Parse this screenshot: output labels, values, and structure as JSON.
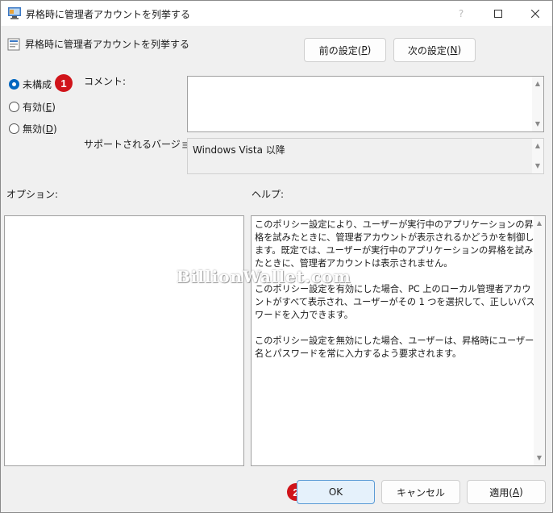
{
  "window": {
    "title": "昇格時に管理者アカウントを列挙する",
    "help_icon": "?",
    "maximize_icon": "maximize-icon",
    "close_icon": "close-icon"
  },
  "policy": {
    "title": "昇格時に管理者アカウントを列挙する"
  },
  "nav": {
    "prev_label": "前の設定(",
    "prev_key": "P",
    "prev_suffix": ")",
    "next_label": "次の設定(",
    "next_key": "N",
    "next_suffix": ")"
  },
  "state": {
    "options": [
      {
        "label": "未構成",
        "key": "",
        "selected": true
      },
      {
        "label": "有効(",
        "key": "E",
        "suffix": ")",
        "selected": false
      },
      {
        "label": "無効(",
        "key": "D",
        "suffix": ")",
        "selected": false
      }
    ]
  },
  "fields": {
    "comment_label": "コメント:",
    "comment_value": "",
    "supported_label": "サポートされるバージョン:",
    "supported_value": "Windows Vista 以降"
  },
  "panes": {
    "options_label": "オプション:",
    "help_label": "ヘルプ:",
    "help_text": "このポリシー設定により、ユーザーが実行中のアプリケーションの昇格を試みたときに、管理者アカウントが表示されるかどうかを制御します。既定では、ユーザーが実行中のアプリケーションの昇格を試みたときに、管理者アカウントは表示されません。\n\nこのポリシー設定を有効にした場合、PC 上のローカル管理者アカウントがすべて表示され、ユーザーがその 1 つを選択して、正しいパスワードを入力できます。\n\nこのポリシー設定を無効にした場合、ユーザーは、昇格時にユーザー名とパスワードを常に入力するよう要求されます。"
  },
  "footer": {
    "ok_label": "OK",
    "cancel_label": "キャンセル",
    "apply_label": "適用(",
    "apply_key": "A",
    "apply_suffix": ")"
  },
  "annotations": {
    "badge1": "1",
    "badge2": "2",
    "watermark": "BillionWallet.com"
  },
  "colors": {
    "accent": "#0067c0",
    "badge": "#d0141a",
    "primary_button_bg": "#e5f1fb"
  }
}
